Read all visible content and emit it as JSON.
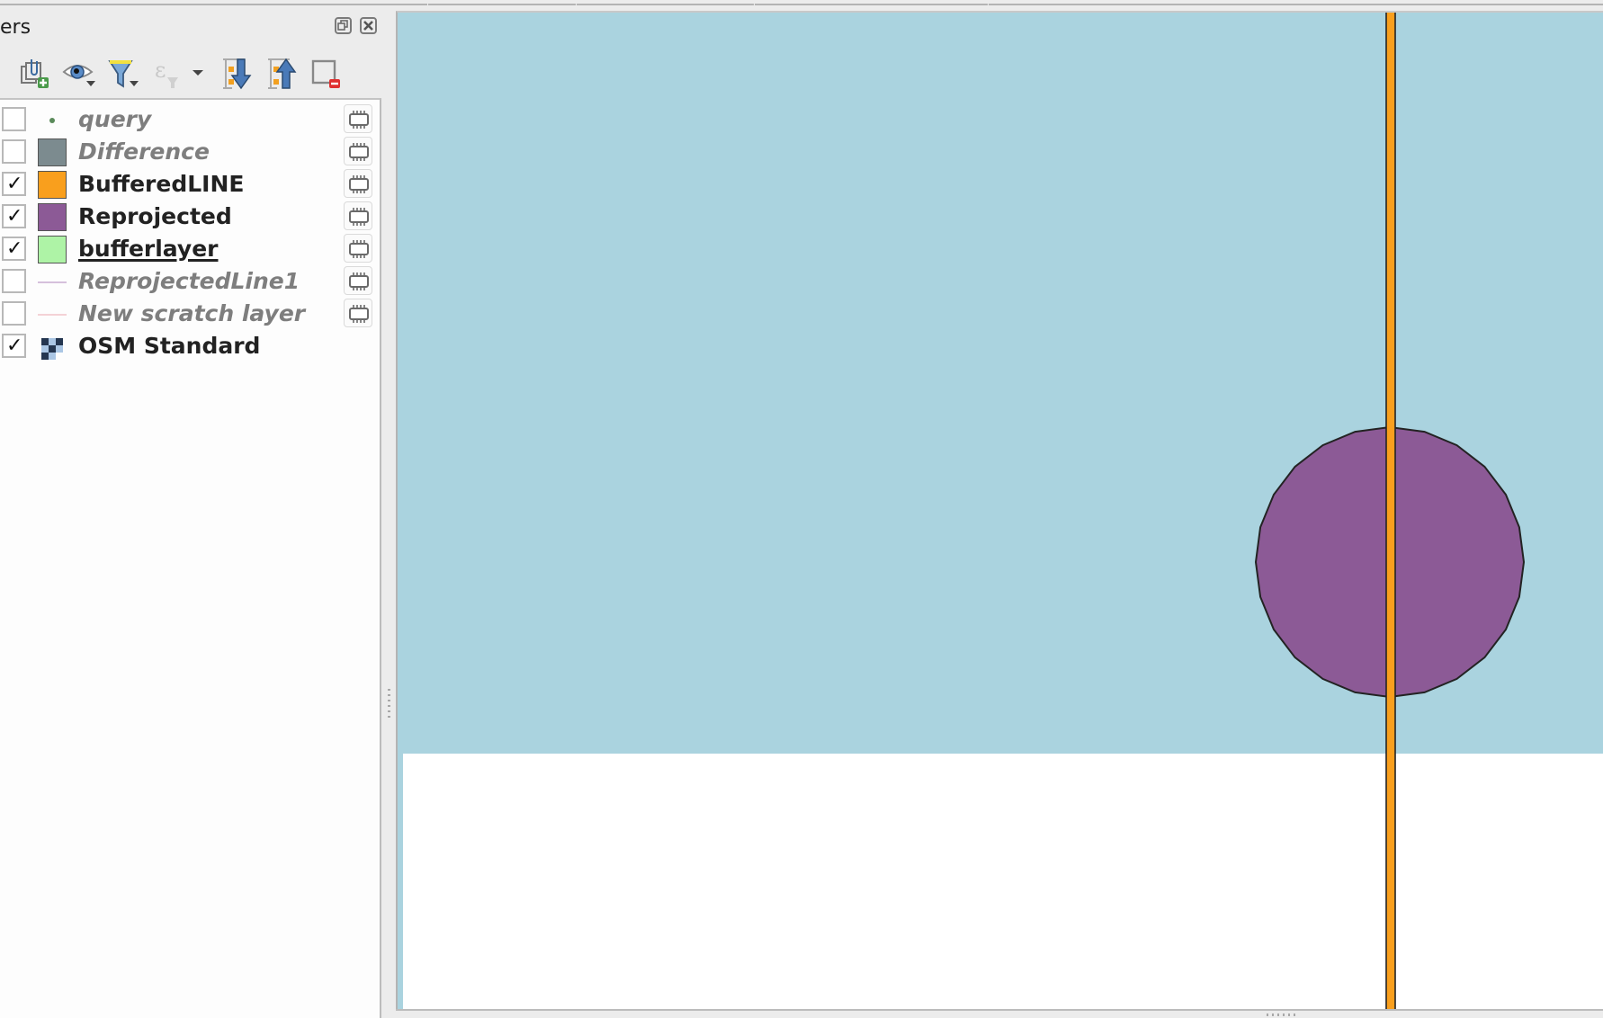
{
  "panel": {
    "title": "ers",
    "float_button": "float-panel",
    "close_button": "close-panel"
  },
  "toolbar": {
    "items": [
      {
        "name": "add-group",
        "icon": "clip-add-icon"
      },
      {
        "name": "manage-visibility",
        "icon": "eye-icon",
        "dropdown": true
      },
      {
        "name": "filter-legend",
        "icon": "filter-icon",
        "dropdown": true
      },
      {
        "name": "filter-by-expression",
        "icon": "expression-filter-icon",
        "enabled": false,
        "dropdown": true
      },
      {
        "name": "expand-all",
        "icon": "expand-all-icon"
      },
      {
        "name": "collapse-all",
        "icon": "collapse-all-icon"
      },
      {
        "name": "remove-layer",
        "icon": "remove-layer-icon"
      }
    ]
  },
  "layers": [
    {
      "name": "query",
      "checked": false,
      "symbol": "point",
      "color": "#5a8a5a",
      "memory": true
    },
    {
      "name": "Difference",
      "checked": false,
      "symbol": "fill",
      "color": "#7c8b8f",
      "memory": true
    },
    {
      "name": "BufferedLINE",
      "checked": true,
      "symbol": "fill",
      "color": "#f99f1d",
      "memory": true
    },
    {
      "name": "Reprojected",
      "checked": true,
      "symbol": "fill",
      "color": "#8c5a96",
      "memory": true
    },
    {
      "name": "bufferlayer",
      "checked": true,
      "symbol": "fill",
      "color": "#aef3a6",
      "memory": true,
      "current": true
    },
    {
      "name": "ReprojectedLine1",
      "checked": false,
      "symbol": "line",
      "color": "#d6c0dc",
      "memory": true
    },
    {
      "name": "New scratch layer",
      "checked": false,
      "symbol": "line",
      "color": "#f4d2d6",
      "memory": true
    },
    {
      "name": "OSM Standard",
      "checked": true,
      "symbol": "raster",
      "memory": false
    }
  ],
  "check_glyph": "✓",
  "map": {
    "background_color": "#aad3df",
    "empty_color": "#ffffff",
    "polygon_fill": "#8c5a96",
    "line_fill": "#f99f1d",
    "stroke": "#232323"
  }
}
